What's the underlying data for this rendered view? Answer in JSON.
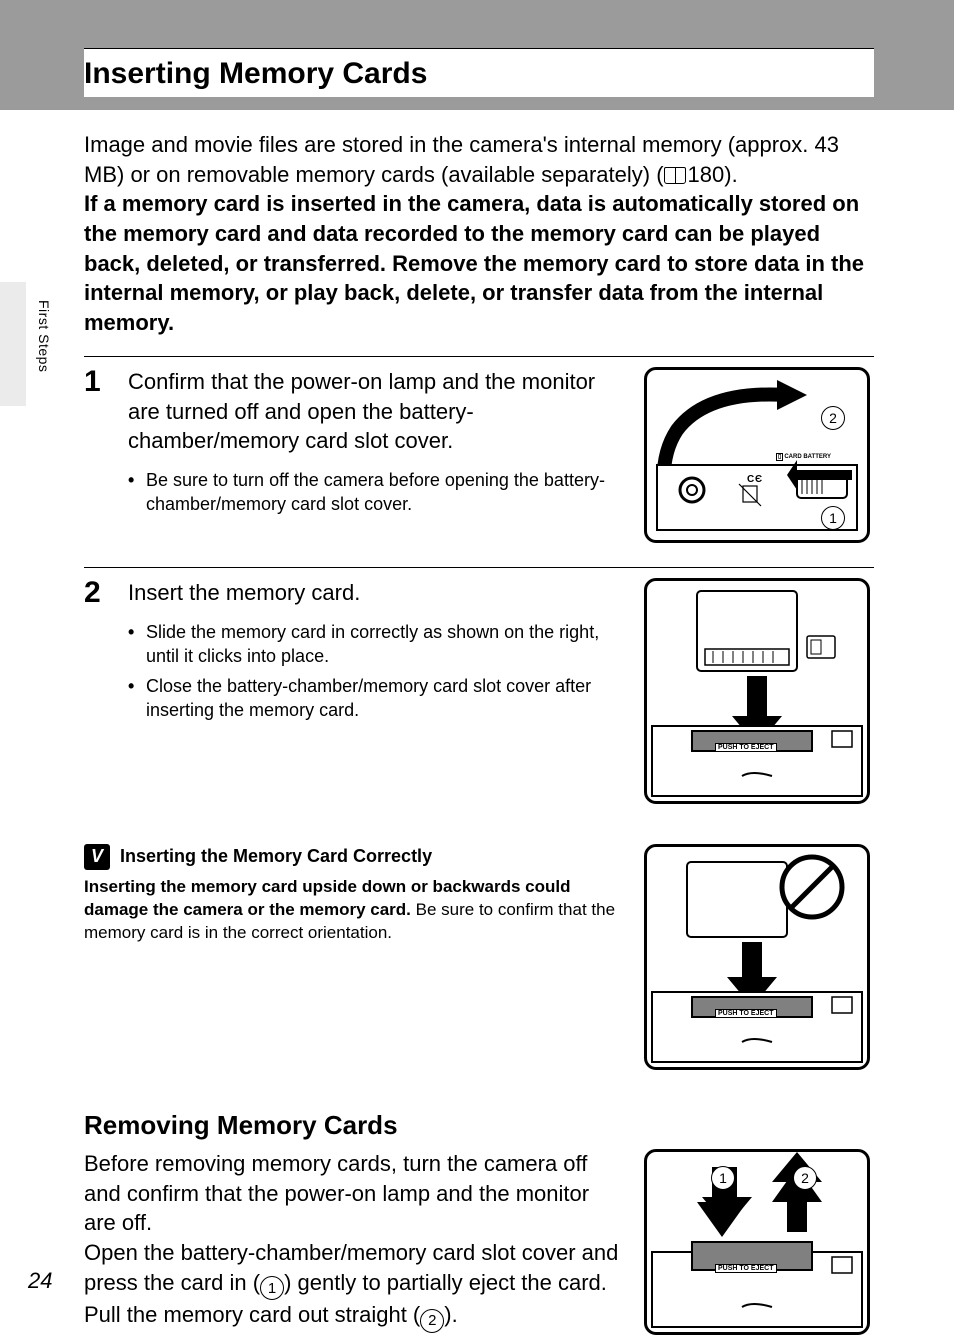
{
  "sidebar": {
    "tab_label": "First Steps"
  },
  "page_number": "24",
  "title": "Inserting Memory Cards",
  "intro_plain": "Image and movie files are stored in the camera's internal memory (approx. 43 MB) or on removable memory cards (available separately) (",
  "intro_ref": "180).",
  "intro_bold": "If a memory card is inserted in the camera, data is automatically stored on the memory card and data recorded to the memory card can be played back, deleted, or transferred. Remove the memory card to store data in the internal memory, or play back, delete, or transfer data from the internal memory.",
  "steps": [
    {
      "num": "1",
      "main": "Confirm that the power-on lamp and the monitor are turned off and open the battery-chamber/memory card slot cover.",
      "bullets": [
        "Be sure to turn off the camera before opening the battery-chamber/memory card slot cover."
      ],
      "callouts": [
        "2",
        "1"
      ]
    },
    {
      "num": "2",
      "main": "Insert the memory card.",
      "bullets": [
        "Slide the memory card in correctly as shown on the right, until it clicks into place.",
        "Close the battery-chamber/memory card slot cover after inserting the memory card."
      ],
      "push_label": "PUSH TO EJECT"
    }
  ],
  "note": {
    "icon_text": "V",
    "title": "Inserting the Memory Card Correctly",
    "bold": "Inserting the memory card upside down or backwards could damage the camera or the memory card.",
    "rest": " Be sure to confirm that the memory card is in the correct orientation.",
    "push_label": "PUSH TO EJECT"
  },
  "removing": {
    "title": "Removing Memory Cards",
    "p1": "Before removing memory cards, turn the camera off and confirm that the power-on lamp and the monitor are off.",
    "p2a": "Open the battery-chamber/memory card slot cover and press the card in (",
    "c1": "1",
    "p2b": ") gently to partially eject the card. Pull the memory card out straight (",
    "c2": "2",
    "p2c": ").",
    "callouts": [
      "1",
      "2"
    ],
    "push_label": "PUSH TO EJECT"
  },
  "fig1_labels": {
    "card_battery": "CARD BATTERY"
  }
}
